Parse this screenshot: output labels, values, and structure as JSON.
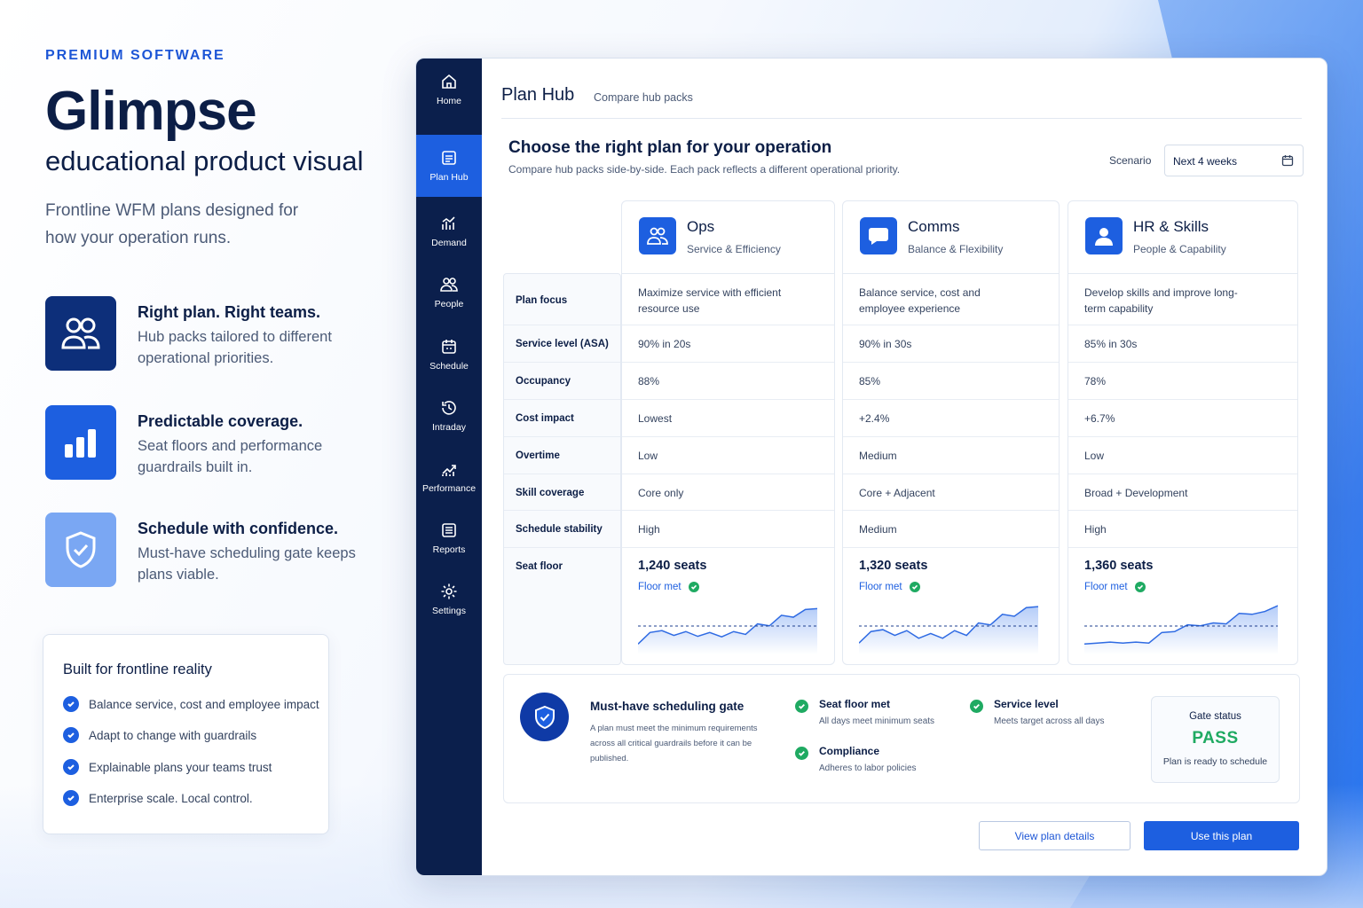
{
  "hero": {
    "eyebrow": "PREMIUM SOFTWARE",
    "brand": "Glimpse",
    "tagline": "educational product visual",
    "sub": "Frontline WFM plans designed for how your operation runs."
  },
  "features": [
    {
      "title": "Right plan. Right teams.",
      "desc": "Hub packs tailored to different operational priorities.",
      "icon": "people-icon",
      "color": "#0d2f7a"
    },
    {
      "title": "Predictable coverage.",
      "desc": "Seat floors and performance guardrails built in.",
      "icon": "bar-chart-icon",
      "color": "#1d5fe0"
    },
    {
      "title": "Schedule with confidence.",
      "desc": "Must-have scheduling gate keeps plans viable.",
      "icon": "shield-icon",
      "color": "#7aa7f3"
    }
  ],
  "built": {
    "title": "Built for frontline reality",
    "items": [
      "Balance service, cost and employee impact",
      "Adapt to change with guardrails",
      "Explainable plans your teams trust",
      "Enterprise scale. Local control."
    ]
  },
  "nav": [
    {
      "label": "Home",
      "icon": "home-icon"
    },
    {
      "label": "Plan Hub",
      "icon": "plan-hub-icon",
      "active": true
    },
    {
      "label": "Demand",
      "icon": "demand-icon"
    },
    {
      "label": "People",
      "icon": "people-icon"
    },
    {
      "label": "Schedule",
      "icon": "calendar-icon"
    },
    {
      "label": "Intraday",
      "icon": "clock-icon"
    },
    {
      "label": "Performance",
      "icon": "trend-icon"
    },
    {
      "label": "Reports",
      "icon": "reports-icon"
    },
    {
      "label": "Settings",
      "icon": "gear-icon"
    }
  ],
  "header": {
    "title": "Plan Hub",
    "subtitle": "Compare hub packs"
  },
  "section": {
    "title": "Choose the right plan for your operation",
    "subtitle": "Compare hub packs side-by-side. Each pack reflects a different operational priority.",
    "scenario_label": "Scenario",
    "scenario_value": "Next 4 weeks"
  },
  "row_labels": [
    "Plan focus",
    "Service level (ASA)",
    "Occupancy",
    "Cost impact",
    "Overtime",
    "Skill coverage",
    "Schedule stability",
    "Seat floor"
  ],
  "plans": [
    {
      "name": "Ops",
      "sub": "Service & Efficiency",
      "icon": "people-icon",
      "values": [
        "Maximize service with efficient resource use",
        "90% in 20s",
        "88%",
        "Lowest",
        "Low",
        "Core only",
        "High"
      ],
      "seats": "1,240 seats",
      "floor": "Floor met",
      "trend": [
        0.18,
        0.42,
        0.46,
        0.36,
        0.44,
        0.34,
        0.42,
        0.33,
        0.44,
        0.38,
        0.6,
        0.56,
        0.78,
        0.74,
        0.9,
        0.92
      ]
    },
    {
      "name": "Comms",
      "sub": "Balance & Flexibility",
      "icon": "chat-icon",
      "values": [
        "Balance service, cost and employee experience",
        "90% in 30s",
        "85%",
        "+2.4%",
        "Medium",
        "Core + Adjacent",
        "Medium"
      ],
      "seats": "1,320 seats",
      "floor": "Floor met",
      "trend": [
        0.2,
        0.44,
        0.48,
        0.36,
        0.46,
        0.3,
        0.4,
        0.3,
        0.46,
        0.36,
        0.62,
        0.58,
        0.8,
        0.76,
        0.94,
        0.96
      ]
    },
    {
      "name": "HR & Skills",
      "sub": "People & Capability",
      "icon": "user-icon",
      "values": [
        "Develop skills and improve long-term capability",
        "85% in 30s",
        "78%",
        "+6.7%",
        "Low",
        "Broad + Development",
        "High"
      ],
      "seats": "1,360 seats",
      "floor": "Floor met",
      "trend": [
        0.18,
        0.2,
        0.22,
        0.2,
        0.22,
        0.2,
        0.42,
        0.44,
        0.58,
        0.56,
        0.62,
        0.6,
        0.82,
        0.8,
        0.86,
        0.98
      ]
    }
  ],
  "gate": {
    "title": "Must-have scheduling gate",
    "desc": "A plan must meet the minimum requirements across all critical guardrails before it can be published.",
    "checks": [
      {
        "title": "Seat floor met",
        "sub": "All days meet minimum seats"
      },
      {
        "title": "Compliance",
        "sub": "Adheres to labor policies"
      },
      {
        "title": "Service level",
        "sub": "Meets target across all days"
      }
    ],
    "status_label": "Gate status",
    "status_value": "PASS",
    "status_note": "Plan is ready to schedule"
  },
  "actions": {
    "secondary": "View plan details",
    "primary": "Use this plan"
  },
  "colors": {
    "accent": "#1d5fe0",
    "navy": "#0b1f4c",
    "success": "#1faa62"
  }
}
